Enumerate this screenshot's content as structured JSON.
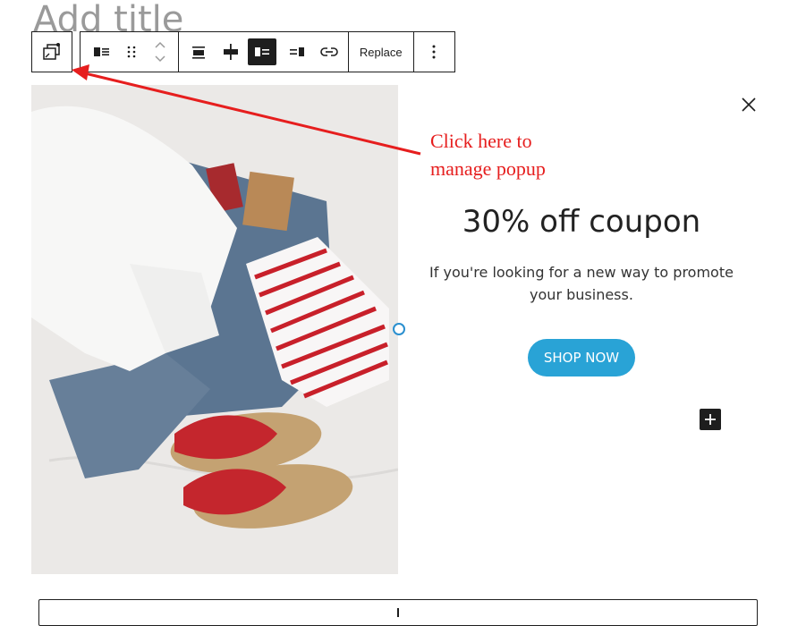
{
  "editor": {
    "title_placeholder": "Add title"
  },
  "toolbar": {
    "popup_icon": "popup-window-icon",
    "items": [
      "image-align-icon",
      "drag-handle-icon",
      "move-up-down-icon",
      "align-center-icon",
      "align-wide-icon",
      "media-left-icon",
      "media-right-icon",
      "link-icon"
    ],
    "replace_label": "Replace",
    "more_icon": "more-vertical-icon"
  },
  "popup": {
    "headline": "30% off coupon",
    "description_line1": "If you're looking for a new way to promote",
    "description_line2": "your business.",
    "cta_label": "SHOP NOW",
    "close_icon": "close-icon",
    "add_block_icon": "plus-icon"
  },
  "annotation": {
    "line1": "Click here to",
    "line2": "manage popup",
    "color": "#e61e1e"
  },
  "colors": {
    "cta": "#29a3d6",
    "toolbar_border": "#1e1e1e",
    "title_placeholder": "#9a9a9a"
  }
}
